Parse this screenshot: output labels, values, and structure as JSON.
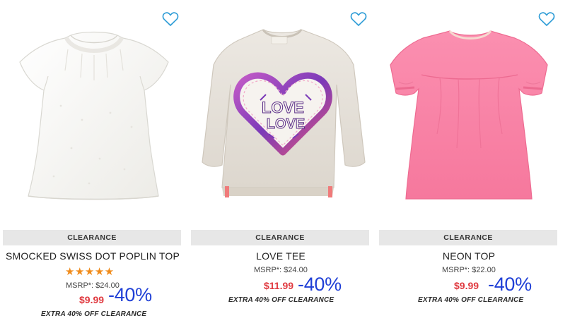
{
  "theme": {
    "badge_bg": "#e7e7e7",
    "price_color": "#e0393f",
    "discount_color": "#1f3fd6",
    "star_color": "#f08b1a",
    "heart_outline_color": "#2b9bd6"
  },
  "products": [
    {
      "badge": "CLEARANCE",
      "name": "SMOCKED SWISS DOT POPLIN TOP",
      "rating_stars": "★★★★★",
      "rating_value": 5,
      "msrp": "MSRP*: $24.00",
      "price": "$9.99",
      "discount": "-40%",
      "promo": "EXTRA 40% OFF CLEARANCE",
      "image_icon": "white-top-image"
    },
    {
      "badge": "CLEARANCE",
      "name": "LOVE TEE",
      "msrp": "MSRP*: $24.00",
      "price": "$11.99",
      "discount": "-40%",
      "promo": "EXTRA 40% OFF CLEARANCE",
      "image_icon": "love-tee-image",
      "graphic_text": [
        "LOVE",
        "LOVE"
      ]
    },
    {
      "badge": "CLEARANCE",
      "name": "NEON TOP",
      "msrp": "MSRP*: $22.00",
      "price": "$9.99",
      "discount": "-40%",
      "promo": "EXTRA 40% OFF CLEARANCE",
      "image_icon": "neon-top-image"
    }
  ]
}
